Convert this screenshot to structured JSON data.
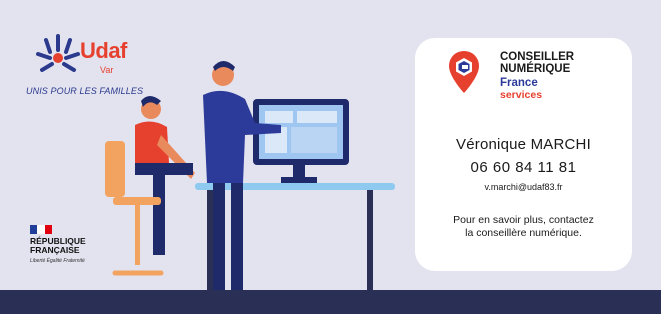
{
  "udaf": {
    "brand": "Udaf",
    "sub": "Var",
    "tagline": "UNIS POUR LES FAMILLES"
  },
  "republique": {
    "title_line1": "RÉPUBLIQUE",
    "title_line2": "FRANÇAISE",
    "motto": "Liberté Égalité Fraternité"
  },
  "conseiller": {
    "title_line1": "CONSEILLER",
    "title_line2": "NUMÉRIQUE",
    "france": "France",
    "services": "services"
  },
  "contact": {
    "name": "Véronique MARCHI",
    "phone": "06 60 84 11 81",
    "email": "v.marchi@udaf83.fr",
    "cta_line1": "Pour en savoir plus, contactez",
    "cta_line2": "la conseillère numérique."
  },
  "colors": {
    "background": "#e3e3f0",
    "navy": "#2a2f55",
    "brand_red": "#e6412f",
    "brand_blue": "#2c3b9a"
  },
  "icons": [
    "udaf-family-icon",
    "french-flag-icon",
    "conseiller-numerique-pin-icon"
  ]
}
